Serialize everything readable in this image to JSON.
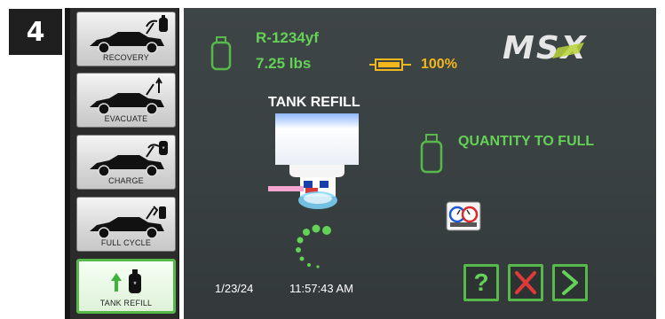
{
  "step_number": "4",
  "sidebar": {
    "items": [
      {
        "label": "RECOVERY",
        "icon": "car-recovery-icon"
      },
      {
        "label": "EVACUATE",
        "icon": "car-evacuate-icon"
      },
      {
        "label": "CHARGE",
        "icon": "car-charge-icon"
      },
      {
        "label": "FULL CYCLE",
        "icon": "car-full-cycle-icon"
      },
      {
        "label": "TANK REFILL",
        "icon": "tank-refill-icon",
        "active": true
      }
    ]
  },
  "status": {
    "refrigerant": "R-1234yf",
    "weight": "7.25 lbs",
    "battery_percent": "100%"
  },
  "brand": "MSX",
  "main": {
    "title": "TANK REFILL",
    "quantity_label": "QUANTITY TO FULL"
  },
  "footer": {
    "date": "1/23/24",
    "time": "11:57:43 AM"
  },
  "actions": {
    "help": "?"
  },
  "colors": {
    "accent_green": "#56b94a",
    "text_green": "#64d157",
    "warning_yellow": "#f2b71c",
    "cancel_red": "#e03a3a"
  }
}
